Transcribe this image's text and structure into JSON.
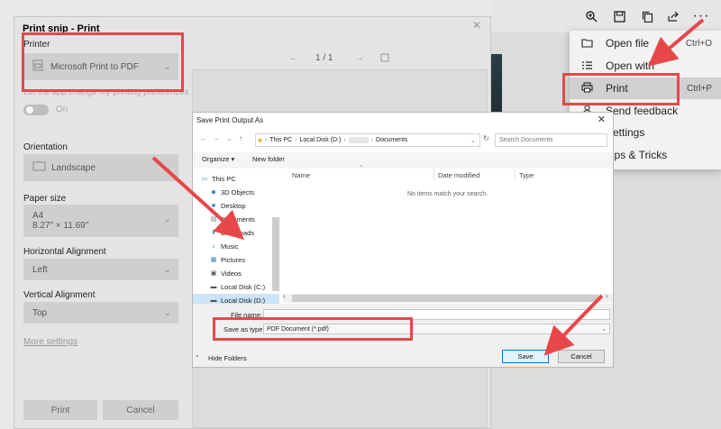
{
  "app_menu": {
    "items": [
      {
        "label": "Open file",
        "icon": "folder-icon",
        "shortcut": "Ctrl+O"
      },
      {
        "label": "Open with",
        "icon": "list-icon",
        "shortcut": ""
      },
      {
        "label": "Print",
        "icon": "printer-icon",
        "shortcut": "Ctrl+P"
      },
      {
        "label": "Send feedback",
        "icon": "feedback-icon",
        "shortcut": ""
      },
      {
        "label": "Settings",
        "icon": "gear-icon",
        "shortcut": ""
      },
      {
        "label": "Tips & Tricks",
        "icon": "lightbulb-icon",
        "shortcut": ""
      }
    ],
    "more_label": "···"
  },
  "print_dialog": {
    "title": "Print snip - Print",
    "printer_label": "Printer",
    "printer_value": "Microsoft Print to PDF",
    "app_pref_label": "Let the app change my printing preferences",
    "toggle_state": "On",
    "orientation_label": "Orientation",
    "orientation_value": "Landscape",
    "paper_size_label": "Paper size",
    "paper_size_value": "A4",
    "paper_size_dims": "8.27\" × 11.69\"",
    "horizontal_label": "Horizontal Alignment",
    "horizontal_value": "Left",
    "vertical_label": "Vertical Alignment",
    "vertical_value": "Top",
    "more_settings": "More settings",
    "print_button": "Print",
    "cancel_button": "Cancel",
    "page_indicator": "1 / 1"
  },
  "save_dialog": {
    "title": "Save Print Output As",
    "breadcrumb": [
      "This PC",
      "Local Disk (D:)",
      "Documents"
    ],
    "search_placeholder": "Search Documents",
    "organize": "Organize ▾",
    "new_folder": "New folder",
    "tree": [
      {
        "label": "This PC",
        "icon": "computer-icon"
      },
      {
        "label": "3D Objects",
        "icon": "cube-icon"
      },
      {
        "label": "Desktop",
        "icon": "desktop-icon"
      },
      {
        "label": "Documents",
        "icon": "document-icon"
      },
      {
        "label": "Downloads",
        "icon": "download-icon"
      },
      {
        "label": "Music",
        "icon": "music-icon"
      },
      {
        "label": "Pictures",
        "icon": "picture-icon"
      },
      {
        "label": "Videos",
        "icon": "video-icon"
      },
      {
        "label": "Local Disk (C:)",
        "icon": "drive-icon"
      },
      {
        "label": "Local Disk (D:)",
        "icon": "drive-icon"
      }
    ],
    "columns": [
      "Name",
      "Date modified",
      "Type"
    ],
    "empty_message": "No items match your search.",
    "file_name_label": "File name:",
    "file_name_value": "",
    "save_as_type_label": "Save as type:",
    "save_as_type_value": "PDF Document (*.pdf)",
    "hide_folders": "Hide Folders",
    "save_button": "Save",
    "cancel_button": "Cancel"
  },
  "accent_color": "#e14a4a"
}
